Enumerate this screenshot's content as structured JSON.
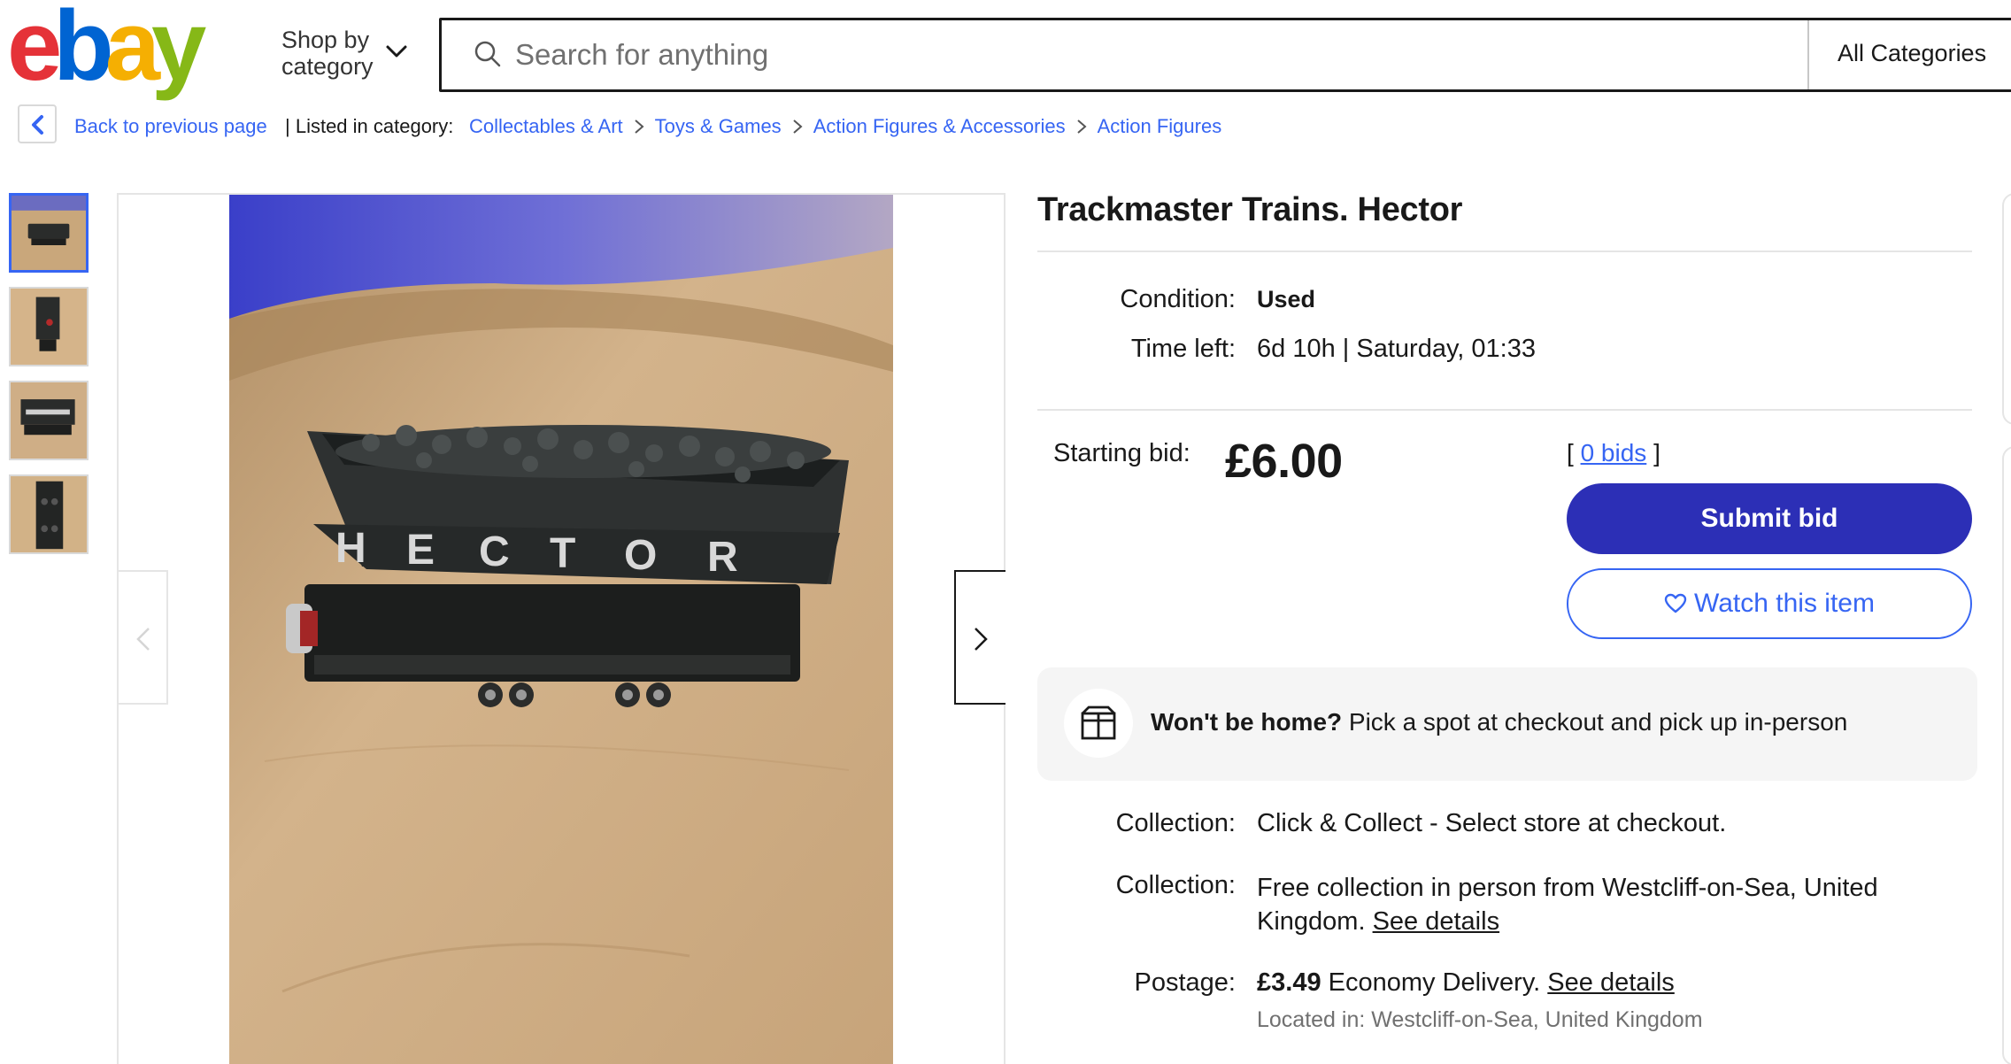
{
  "header": {
    "logo_text": "ebay",
    "shop_by_line1": "Shop by",
    "shop_by_line2": "category",
    "search_placeholder": "Search for anything",
    "category_select": "All Categories"
  },
  "breadcrumb": {
    "back_label": "Back to previous page",
    "listed_label": "| Listed in category:",
    "items": [
      "Collectables & Art",
      "Toys & Games",
      "Action Figures & Accessories",
      "Action Figures"
    ]
  },
  "gallery": {
    "thumbnail_count": 4,
    "selected_index": 0,
    "photo_text": "HECTOR"
  },
  "listing": {
    "title": "Trackmaster Trains. Hector",
    "condition_label": "Condition:",
    "condition_value": "Used",
    "time_left_label": "Time left:",
    "time_left_value": "6d 10h",
    "time_left_sep": "|",
    "time_left_end": "Saturday, 01:33",
    "starting_bid_label": "Starting bid:",
    "price": "£6.00",
    "bids_open": "[",
    "bids_link": "0 bids",
    "bids_close": "]",
    "submit_bid_label": "Submit bid",
    "watch_label": "Watch this item"
  },
  "pickup": {
    "bold": "Won't be home?",
    "text": " Pick a spot at checkout and pick up in-person"
  },
  "delivery": {
    "collection1_label": "Collection:",
    "collection1_value": "Click & Collect - Select store at checkout.",
    "collection2_label": "Collection:",
    "collection2_value_line1": "Free collection in person from Westcliff-on-Sea, United",
    "collection2_value_line2": "Kingdom.",
    "see_details_1": "See details",
    "postage_label": "Postage:",
    "postage_price": "£3.49",
    "postage_text": " Economy Delivery.",
    "see_details_2": "See details",
    "located": "Located in: Westcliff-on-Sea, United Kingdom"
  },
  "colors": {
    "link_blue": "#3665f3",
    "primary_button": "#2c2fb6",
    "logo_e": "#e53238",
    "logo_b": "#0064d2",
    "logo_a": "#f5af02",
    "logo_y": "#86b817"
  },
  "icons": [
    "chevron-down-icon",
    "search-icon",
    "chevron-left-icon",
    "chevron-right-icon",
    "heart-icon",
    "box-icon"
  ]
}
